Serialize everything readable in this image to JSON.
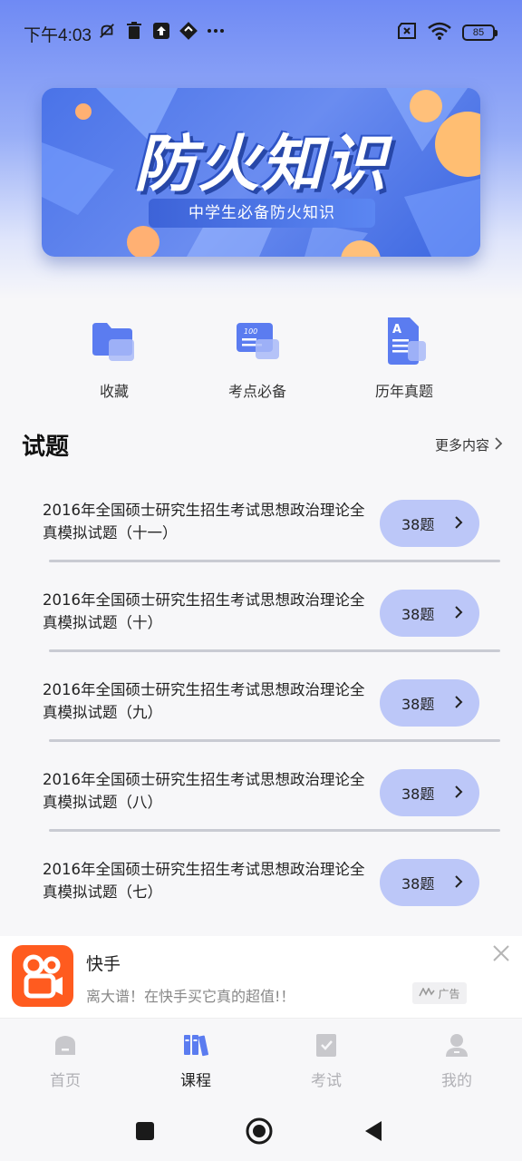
{
  "status_bar": {
    "time": "下午4:03",
    "battery": "85",
    "icons_left": [
      "mute-bell-icon",
      "trash-icon",
      "upload-icon",
      "app-icon",
      "more-dots-icon"
    ],
    "icons_right": [
      "sim-x-icon",
      "wifi-icon",
      "battery-icon"
    ]
  },
  "banner": {
    "title": "防火知识",
    "subtitle": "中学生必备防火知识"
  },
  "quick_nav": [
    {
      "label": "收藏",
      "icon": "folder-icon"
    },
    {
      "label": "考点必备",
      "icon": "notebook-icon"
    },
    {
      "label": "历年真题",
      "icon": "document-icon"
    }
  ],
  "section": {
    "title": "试题",
    "more": "更多内容"
  },
  "exams": [
    {
      "title": "2016年全国硕士研究生招生考试思想政治理论全真模拟试题（十一）",
      "count": "38题"
    },
    {
      "title": "2016年全国硕士研究生招生考试思想政治理论全真模拟试题（十）",
      "count": "38题"
    },
    {
      "title": "2016年全国硕士研究生招生考试思想政治理论全真模拟试题（九）",
      "count": "38题"
    },
    {
      "title": "2016年全国硕士研究生招生考试思想政治理论全真模拟试题（八）",
      "count": "38题"
    },
    {
      "title": "2016年全国硕士研究生招生考试思想政治理论全真模拟试题（七）",
      "count": "38题"
    }
  ],
  "ad": {
    "name": "快手",
    "description": "离大谱！在快手买它真的超值!！",
    "tag": "广告"
  },
  "bottom_nav": [
    {
      "label": "首页",
      "icon": "home-icon",
      "active": false
    },
    {
      "label": "课程",
      "icon": "books-icon",
      "active": true
    },
    {
      "label": "考试",
      "icon": "exam-icon",
      "active": false
    },
    {
      "label": "我的",
      "icon": "profile-icon",
      "active": false
    }
  ],
  "colors": {
    "accent": "#5b7cf0",
    "button_bg": "#bcc7f8",
    "ad_brand": "#ff5b1f",
    "inactive": "#b0b0b5"
  }
}
